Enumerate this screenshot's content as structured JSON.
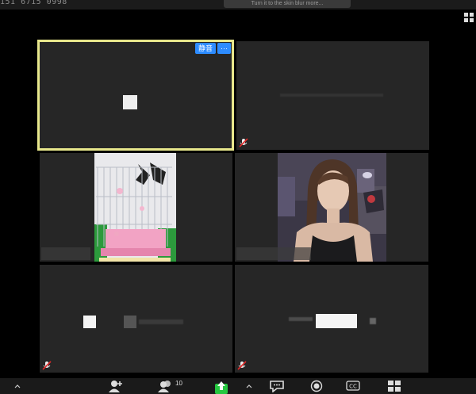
{
  "window": {
    "meeting_id": "151 6715 0998",
    "banner_text": "Turn it to the skin blur more..."
  },
  "tiles": [
    {
      "id": "self",
      "hover_buttons": [
        "静音",
        "···"
      ]
    }
  ],
  "participant_count": "10",
  "toolbar": {
    "items": [
      "invite-icon",
      "participants-icon",
      "share-screen-icon",
      "chat-icon",
      "record-icon",
      "closed-caption-icon",
      "gallery-view-icon"
    ],
    "cc_label": "CC"
  },
  "colors": {
    "active_border": "#e8e78c",
    "accent": "#2d8cff",
    "share_green": "#26c740",
    "tile_bg": "#262626"
  }
}
